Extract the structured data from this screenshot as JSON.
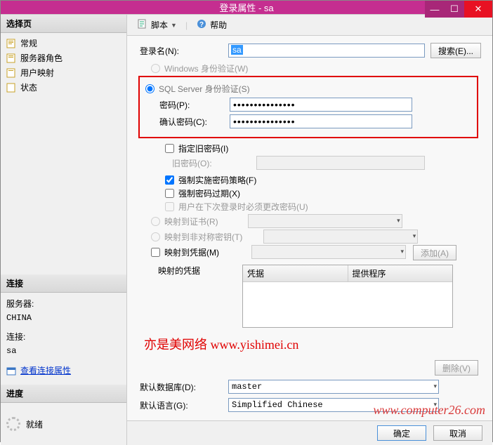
{
  "titlebar": {
    "title": "登录属性 - sa"
  },
  "sidebar": {
    "select_page": "选择页",
    "nav": [
      "常规",
      "服务器角色",
      "用户映射",
      "状态"
    ],
    "connection_header": "连接",
    "server_label": "服务器:",
    "server_value": "CHINA",
    "conn_label": "连接:",
    "conn_value": "sa",
    "view_conn_props": "查看连接属性",
    "progress_header": "进度",
    "ready": "就绪"
  },
  "toolbar": {
    "script": "脚本",
    "help": "帮助"
  },
  "form": {
    "login_name_label": "登录名(N):",
    "login_name_value": "sa",
    "search_btn": "搜索(E)...",
    "windows_auth": "Windows 身份验证(W)",
    "sql_auth": "SQL Server 身份验证(S)",
    "password_label": "密码(P):",
    "password_value": "●●●●●●●●●●●●●●●",
    "confirm_label": "确认密码(C):",
    "confirm_value": "●●●●●●●●●●●●●●●",
    "specify_old": "指定旧密码(I)",
    "old_pwd_label": "旧密码(O):",
    "enforce_policy": "强制实施密码策略(F)",
    "enforce_expire": "强制密码过期(X)",
    "must_change": "用户在下次登录时必须更改密码(U)",
    "map_cert": "映射到证书(R)",
    "map_asym": "映射到非对称密钥(T)",
    "map_cred": "映射到凭据(M)",
    "add_btn": "添加(A)",
    "mapped_creds": "映射的凭据",
    "col_cred": "凭据",
    "col_provider": "提供程序",
    "delete_btn": "删除(V)",
    "default_db_label": "默认数据库(D):",
    "default_db_value": "master",
    "default_lang_label": "默认语言(G):",
    "default_lang_value": "Simplified Chinese",
    "watermark1": "亦是美网络 www.yishimei.cn",
    "watermark2": "www.computer26.com"
  },
  "buttons": {
    "ok": "确定",
    "cancel": "取消"
  }
}
